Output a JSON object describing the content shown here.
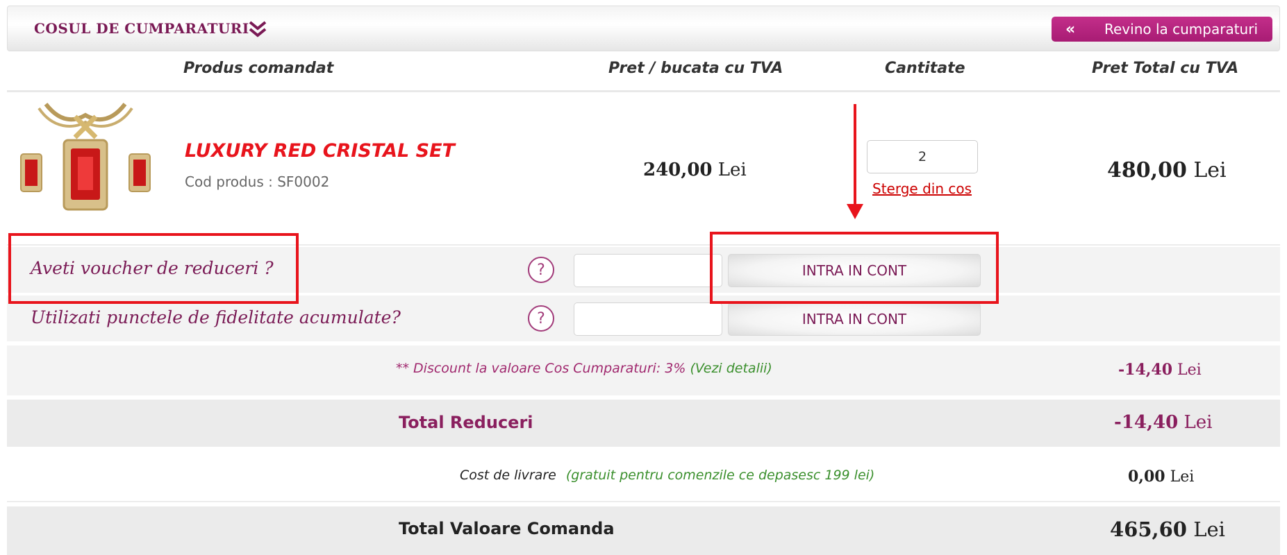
{
  "header": {
    "title": "COSUL DE CUMPARATURI",
    "back_button": "Revino la cumparaturi"
  },
  "columns": {
    "product": "Produs comandat",
    "unit_price": "Pret / bucata cu TVA",
    "quantity": "Cantitate",
    "total_price": "Pret Total cu TVA"
  },
  "item": {
    "name": "LUXURY RED CRISTAL SET",
    "code": "Cod produs : SF0002",
    "unit_price_value": "240,00",
    "unit_price_currency": "Lei",
    "quantity": "2",
    "remove_link": "Sterge din cos",
    "total_value": "480,00",
    "total_currency": "Lei"
  },
  "voucher": {
    "label": "Aveti voucher de reduceri ?",
    "help": "?",
    "button": "INTRA IN CONT"
  },
  "loyalty": {
    "label": "Utilizati punctele de fidelitate acumulate?",
    "help": "?",
    "button": "INTRA IN CONT"
  },
  "discount": {
    "text": "** Discount la valoare Cos Cumparaturi: 3%",
    "details_link": "(Vezi detalii)",
    "value": "-14,40",
    "currency": "Lei"
  },
  "total_discounts": {
    "label": "Total Reduceri",
    "value": "-14,40",
    "currency": "Lei"
  },
  "delivery": {
    "label": "Cost de livrare",
    "note": "(gratuit pentru comenzile ce depasesc 199 lei)",
    "value": "0,00",
    "currency": "Lei"
  },
  "order_total": {
    "label": "Total Valoare Comanda",
    "value": "465,60",
    "currency": "Lei"
  },
  "colors": {
    "brand": "#a81c74",
    "accent_text": "#7a1a55",
    "annotation_red": "#e8141c",
    "green": "#3a8f2c"
  },
  "icons": {
    "header": "chevron-double-down-icon",
    "back": "chevron-double-left-icon",
    "help": "question-circle-icon"
  }
}
